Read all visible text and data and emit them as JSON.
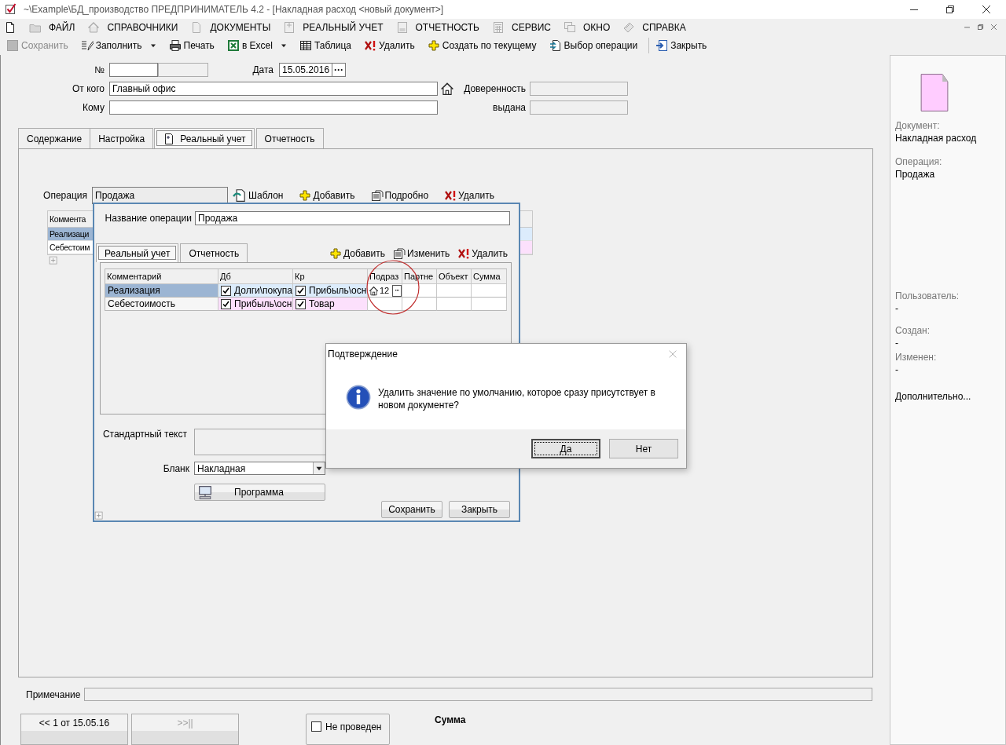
{
  "window": {
    "title": "~\\Example\\БД_производство  ПРЕДПРИНИМАТЕЛЬ 4.2 - [Накладная расход <новый документ>]"
  },
  "menu": [
    {
      "kind": "folder",
      "label": "ФАЙЛ"
    },
    {
      "kind": "home",
      "label": "СПРАВОЧНИКИ"
    },
    {
      "kind": "document",
      "label": "ДОКУМЕНТЫ"
    },
    {
      "kind": "ledger",
      "label": "РЕАЛЬНЫЙ УЧЕТ"
    },
    {
      "kind": "report",
      "label": "ОТЧЕТНОСТЬ"
    },
    {
      "kind": "calculator",
      "label": "СЕРВИС"
    },
    {
      "kind": "windows",
      "label": "ОКНО"
    },
    {
      "kind": "book",
      "label": "СПРАВКА"
    }
  ],
  "toolbar": [
    {
      "kind": "save",
      "label": "Сохранить",
      "disabled": true
    },
    {
      "kind": "fill",
      "label": "Заполнить",
      "disabled": false,
      "dropdown": true
    },
    {
      "kind": "printer",
      "label": "Печать",
      "disabled": false
    },
    {
      "kind": "excel",
      "label": "в Excel",
      "disabled": false,
      "dropdown": true
    },
    {
      "kind": "table",
      "label": "Таблица",
      "disabled": false
    },
    {
      "kind": "delete",
      "label": "Удалить",
      "disabled": false
    },
    {
      "kind": "add",
      "label": "Создать по текущему",
      "disabled": false
    },
    {
      "kind": "select",
      "label": "Выбор операции",
      "disabled": false
    },
    {
      "kind": "closewin",
      "label": "Закрыть",
      "disabled": false,
      "separator": true
    }
  ],
  "form": {
    "number": {
      "label": "№"
    },
    "date": {
      "label": "Дата",
      "value": "15.05.2016",
      "button": "···"
    },
    "from": {
      "label": "От кого",
      "value": "Главный офис"
    },
    "to": {
      "label": "Кому"
    },
    "proxy": {
      "label": "Доверенность",
      "disabled": true
    },
    "issued": {
      "label": "выдана",
      "disabled": true
    }
  },
  "tabs": [
    {
      "label": "Содержание",
      "selected": false
    },
    {
      "label": "Настройка",
      "selected": false
    },
    {
      "label": "Реальный учет",
      "selected": true,
      "has_icon": true
    },
    {
      "label": "Отчетность",
      "selected": false
    }
  ],
  "operation": {
    "label": "Операция",
    "value": "Продажа",
    "actions": [
      {
        "kind": "template",
        "label": "Шаблон"
      },
      {
        "kind": "add",
        "label": "Добавить"
      },
      {
        "kind": "details",
        "label": "Подробно"
      },
      {
        "kind": "delete",
        "label": "Удалить"
      }
    ]
  },
  "background_grid": {
    "header": "Коммента",
    "rows": [
      {
        "text": "Реализаци",
        "selected": true,
        "color": "#dcecfc"
      },
      {
        "text": "Себестоим",
        "selected": false,
        "color": "#fce0fc"
      }
    ]
  },
  "operation_dialog": {
    "name_label": "Название операции",
    "name_value": "Продажа",
    "tabs": [
      {
        "label": "Реальный учет",
        "selected": true
      },
      {
        "label": "Отчетность",
        "selected": false
      }
    ],
    "actions": [
      {
        "kind": "add",
        "label": "Добавить"
      },
      {
        "kind": "details",
        "label": "Изменить"
      },
      {
        "kind": "delete",
        "label": "Удалить"
      }
    ],
    "table": {
      "columns": [
        "Комментарий",
        "Дб",
        "Кр",
        "Подраз",
        "Партне",
        "Объект",
        "Сумма"
      ],
      "rows": [
        {
          "selected": true,
          "comment": "Реализация",
          "debit": {
            "checked": true,
            "account": "Долги\\покупа",
            "color": "#dcecfc"
          },
          "credit": {
            "checked": true,
            "account": "Прибыль\\осн",
            "color": "#dcecfc"
          },
          "division": {
            "value": "12",
            "button": "···"
          }
        },
        {
          "selected": false,
          "comment": "Себестоимость",
          "debit": {
            "checked": true,
            "account": "Прибыль\\осн",
            "color": "#fce0fc"
          },
          "credit": {
            "checked": true,
            "account": "Товар",
            "color": "#fce0fc"
          }
        }
      ]
    },
    "standard_text_label": "Стандартный текст",
    "blank": {
      "label": "Бланк",
      "value": "Накладная"
    },
    "program_button": "Программа",
    "buttons": [
      "Сохранить",
      "Закрыть"
    ]
  },
  "confirm": {
    "title": "Подтверждение",
    "message": "Удалить значение по умолчанию, которое сразу присутствует в новом документе?",
    "buttons": [
      {
        "label": "Да",
        "default": true
      },
      {
        "label": "Нет",
        "default": false
      }
    ]
  },
  "note": {
    "label": "Примечание"
  },
  "footer": {
    "prev_button": "<< 1 от 15.05.16",
    "next_button": {
      "label": ">>||",
      "disabled": true
    },
    "posted": {
      "label": "Не проведен",
      "checked": false
    },
    "sum_label": "Сумма"
  },
  "info_panel": {
    "document_fields": [
      {
        "label": "Документ:",
        "value": "Накладная расход"
      },
      {
        "label": "Операция:",
        "value": "Продажа"
      }
    ],
    "audit_fields": [
      {
        "label": "Пользователь:",
        "value": "-"
      },
      {
        "label": "Создан:",
        "value": "-"
      },
      {
        "label": "Изменен:",
        "value": "-"
      }
    ],
    "more": "Дополнительно..."
  }
}
